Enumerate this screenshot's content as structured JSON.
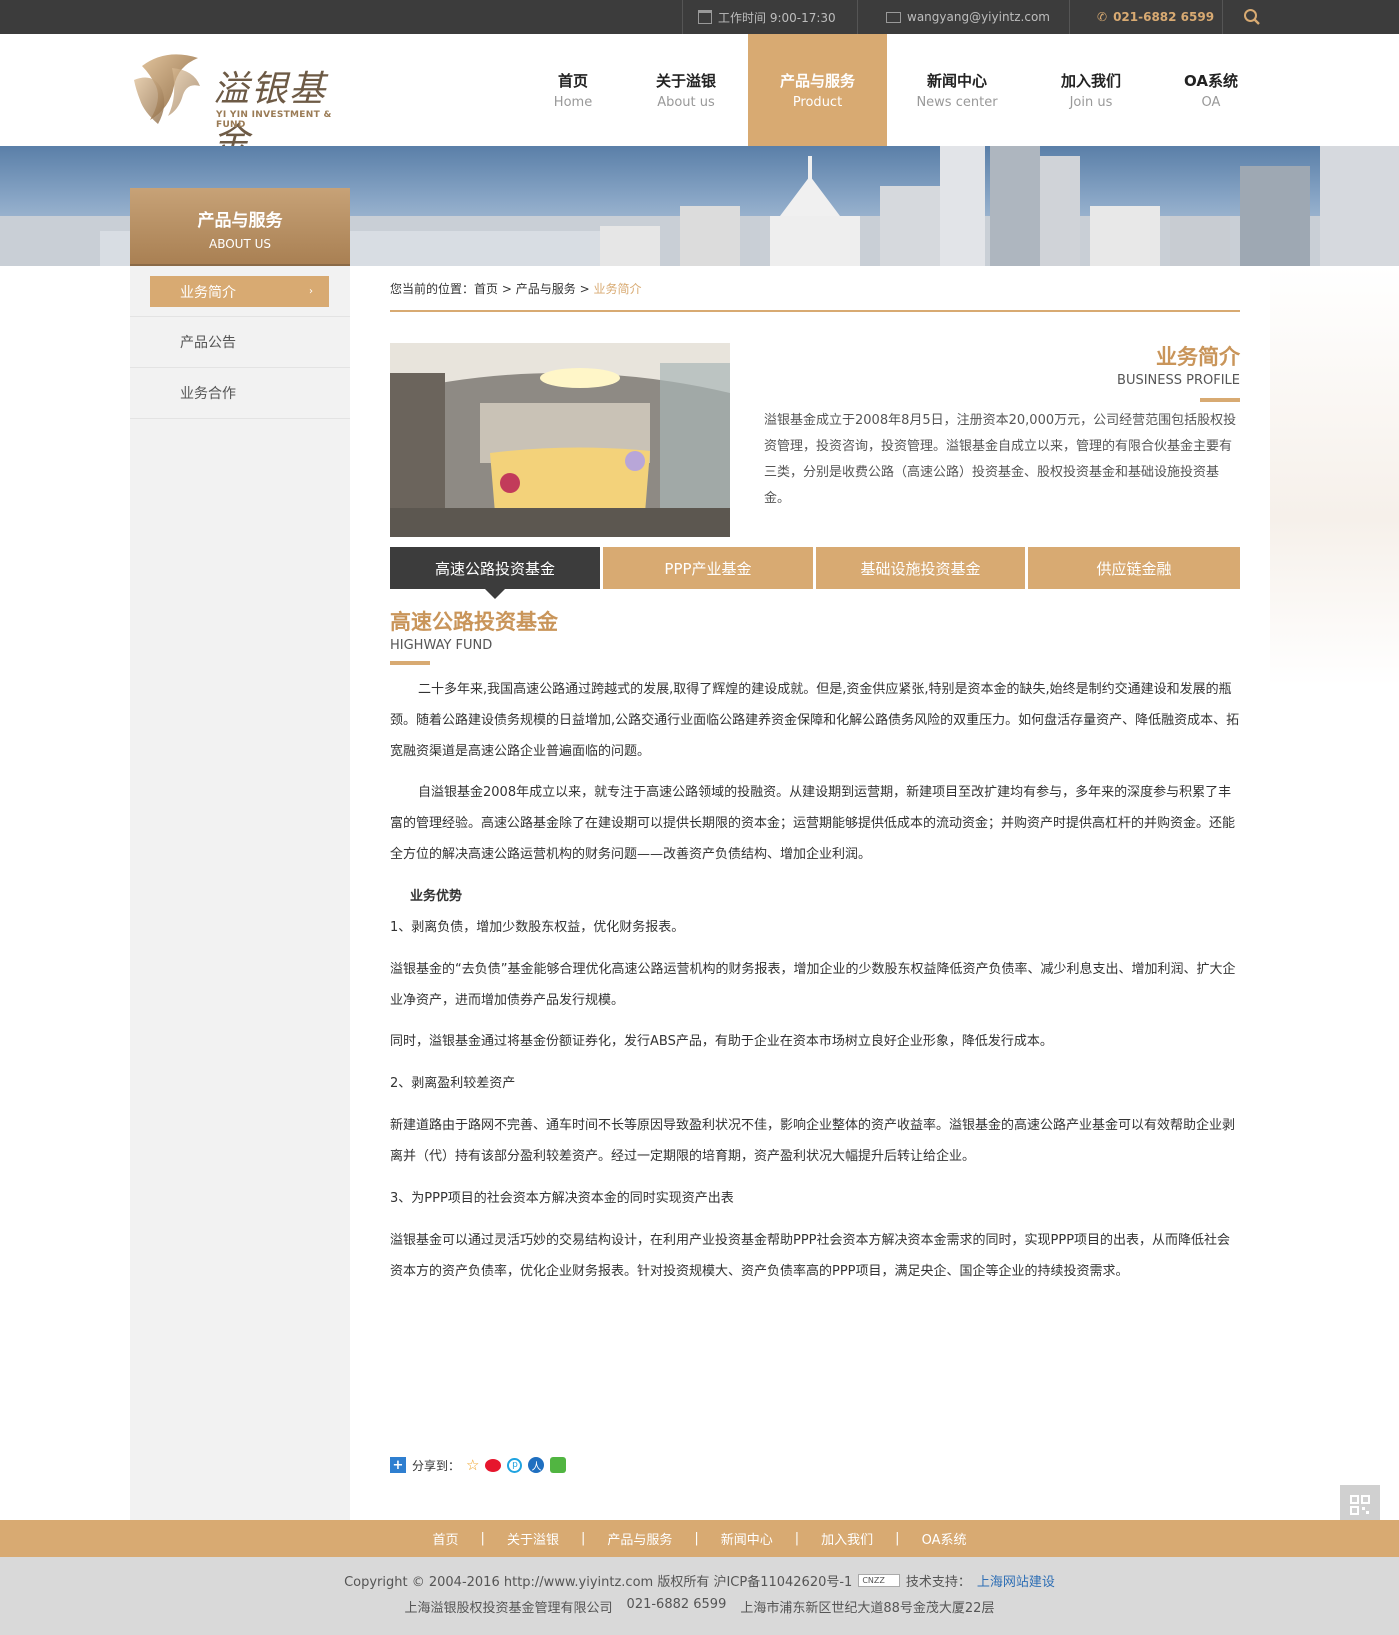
{
  "topbar": {
    "hours": "工作时间 9:00-17:30",
    "email": "wangyang@yiyintz.com",
    "phone": "021-6882 6599"
  },
  "logo": {
    "cn": "溢银基金",
    "en": "YI YIN INVESTMENT & FUND"
  },
  "nav": [
    {
      "cn": "首页",
      "en": "Home"
    },
    {
      "cn": "关于溢银",
      "en": "About us"
    },
    {
      "cn": "产品与服务",
      "en": "Product"
    },
    {
      "cn": "新闻中心",
      "en": "News center"
    },
    {
      "cn": "加入我们",
      "en": "Join us"
    },
    {
      "cn": "OA系统",
      "en": "OA"
    }
  ],
  "sidebar": {
    "title_cn": "产品与服务",
    "title_en": "ABOUT US",
    "items": [
      {
        "label": "业务简介"
      },
      {
        "label": "产品公告"
      },
      {
        "label": "业务合作"
      }
    ]
  },
  "breadcrumb": {
    "prefix": "您当前的位置：",
    "home": "首页",
    "sep": ">",
    "section": "产品与服务",
    "current": "业务简介"
  },
  "intro": {
    "title_cn": "业务简介",
    "title_en": "BUSINESS PROFILE",
    "text": "溢银基金成立于2008年8月5日，注册资本20,000万元，公司经营范围包括股权投资管理，投资咨询，投资管理。溢银基金自成立以来，管理的有限合伙基金主要有三类，分别是收费公路（高速公路）投资基金、股权投资基金和基础设施投资基金。"
  },
  "tabs": [
    {
      "label": "高速公路投资基金"
    },
    {
      "label": "PPP产业基金"
    },
    {
      "label": "基础设施投资基金"
    },
    {
      "label": "供应链金融"
    }
  ],
  "content": {
    "title_cn": "高速公路投资基金",
    "title_en": "HIGHWAY FUND",
    "p1": "二十多年来,我国高速公路通过跨越式的发展,取得了辉煌的建设成就。但是,资金供应紧张,特别是资本金的缺失,始终是制约交通建设和发展的瓶颈。随着公路建设债务规模的日益增加,公路交通行业面临公路建养资金保障和化解公路债务风险的双重压力。如何盘活存量资产、降低融资成本、拓宽融资渠道是高速公路企业普遍面临的问题。",
    "p2": "自溢银基金2008年成立以来，就专注于高速公路领域的投融资。从建设期到运营期，新建项目至改扩建均有参与，多年来的深度参与积累了丰富的管理经验。高速公路基金除了在建设期可以提供长期限的资本金；运营期能够提供低成本的流动资金；并购资产时提供高杠杆的并购资金。还能全方位的解决高速公路运营机构的财务问题——改善资产负债结构、增加企业利润。",
    "adv_title": "业务优势",
    "h1": "1、剥离负债，增加少数股东权益，优化财务报表。",
    "p3": "溢银基金的“去负债”基金能够合理优化高速公路运营机构的财务报表，增加企业的少数股东权益降低资产负债率、减少利息支出、增加利润、扩大企业净资产，进而增加债券产品发行规模。",
    "p4": "同时，溢银基金通过将基金份额证券化，发行ABS产品，有助于企业在资本市场树立良好企业形象，降低发行成本。",
    "h2": "2、剥离盈利较差资产",
    "p5": "新建道路由于路网不完善、通车时间不长等原因导致盈利状况不佳，影响企业整体的资产收益率。溢银基金的高速公路产业基金可以有效帮助企业剥离并（代）持有该部分盈利较差资产。经过一定期限的培育期，资产盈利状况大幅提升后转让给企业。",
    "h3": "3、为PPP项目的社会资本方解决资本金的同时实现资产出表",
    "p6": "溢银基金可以通过灵活巧妙的交易结构设计，在利用产业投资基金帮助PPP社会资本方解决资本金需求的同时，实现PPP项目的出表，从而降低社会资本方的资产负债率，优化企业财务报表。针对投资规模大、资产负债率高的PPP项目，满足央企、国企等企业的持续投资需求。"
  },
  "share": {
    "label": "分享到："
  },
  "footer_nav": [
    "首页",
    "关于溢银",
    "产品与服务",
    "新闻中心",
    "加入我们",
    "OA系统"
  ],
  "footer_sep": "|",
  "footer": {
    "copyright": "Copyright © 2004-2016 http://www.yiyintz.com 版权所有 沪ICP备11042620号-1",
    "cnzz": "CNZZ",
    "tech_label": "技术支持：",
    "tech_link": "上海网站建设",
    "company": "上海溢银股权投资基金管理有限公司",
    "phone": "021-6882 6599",
    "address": "上海市浦东新区世纪大道88号金茂大厦22层"
  },
  "colors": {
    "accent": "#d8aa72",
    "dark": "#3c3c3c",
    "title": "#c9955a"
  }
}
